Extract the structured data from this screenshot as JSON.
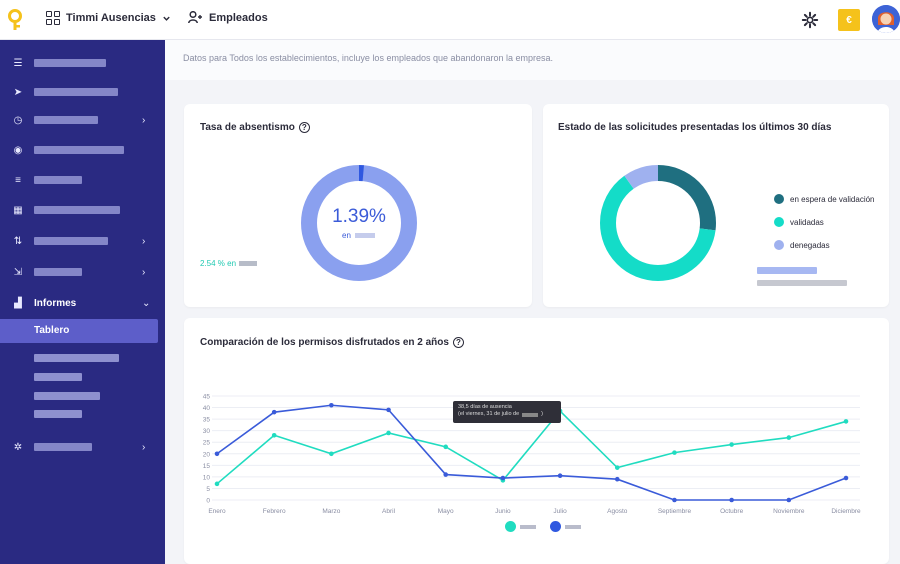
{
  "topbar": {
    "app_name": "Timmi Ausencias",
    "employees_label": "Empleados",
    "currency_symbol": "€"
  },
  "sidebar": {
    "active_section_label": "Informes",
    "active_item_label": "Tablero"
  },
  "notice": "Datos para Todos los establecimientos, incluye los empleados que abandonaron la empresa.",
  "absenteeism": {
    "title": "Tasa de absentismo",
    "value": "1.39%",
    "sub": "en",
    "comparison": "2.54 % en",
    "ring_fraction": 0.0139
  },
  "requests": {
    "title": "Estado de las solicitudes presentadas los últimos 30 días",
    "legend": [
      "en espera de validación",
      "validadas",
      "denegadas"
    ],
    "colors": {
      "pending": "#1f6f80",
      "validated": "#14dcc8",
      "denied": "#9fb1ef"
    }
  },
  "comparison": {
    "title": "Comparación de los permisos disfrutados en 2 años",
    "tooltip_line1": "38,5 días de ausencia",
    "tooltip_line2": "(el viernes, 31 de julio de"
  },
  "chart_data": [
    {
      "type": "pie",
      "title": "Tasa de absentismo",
      "values": [
        1.39,
        98.61
      ]
    },
    {
      "type": "pie",
      "title": "Estado de las solicitudes presentadas los últimos 30 días",
      "categories": [
        "en espera de validación",
        "validadas",
        "denegadas"
      ],
      "values": [
        27,
        63,
        10
      ]
    },
    {
      "type": "line",
      "title": "Comparación de los permisos disfrutados en 2 años",
      "categories": [
        "Enero",
        "Febrero",
        "Marzo",
        "Abril",
        "Mayo",
        "Junio",
        "Julio",
        "Agosto",
        "Septiembre",
        "Octubre",
        "Noviembre",
        "Diciembre"
      ],
      "series": [
        {
          "color": "#20dcc0",
          "values": [
            7,
            28,
            20,
            29,
            23,
            8.5,
            38.5,
            14,
            20.5,
            24,
            27,
            34
          ]
        },
        {
          "color": "#3a5bd9",
          "values": [
            20,
            38,
            41,
            39,
            11,
            9.5,
            10.5,
            9,
            0,
            0,
            0,
            9.5
          ]
        }
      ],
      "yticks": [
        0,
        5,
        10,
        15,
        20,
        25,
        30,
        35,
        40,
        45
      ],
      "ylim": [
        0,
        45
      ],
      "grid": true
    }
  ]
}
